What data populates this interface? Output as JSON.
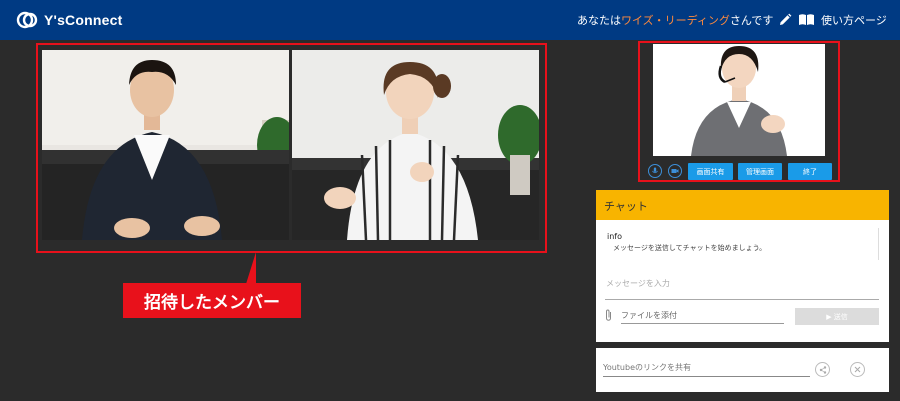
{
  "header": {
    "logo_text": "Y'sConnect",
    "greeting_prefix": "あなたは",
    "user_name": "ワイズ・リーディング",
    "greeting_suffix": "さんです",
    "help_label": "使い方ページ"
  },
  "callout": {
    "label": "招待したメンバー"
  },
  "operator_controls": {
    "share_screen": "画面共有",
    "manage_screen": "管理画面",
    "end": "終了"
  },
  "chat": {
    "title": "チャット",
    "info_title": "info",
    "info_message": "メッセージを送信してチャットを始めましょう。",
    "message_placeholder": "メッセージを入力",
    "file_placeholder": "ファイルを添付",
    "send_label": "▶ 送信"
  },
  "youtube": {
    "placeholder": "Youtubeのリンクを共有"
  },
  "colors": {
    "header": "#003a83",
    "highlight": "#e8111b",
    "chat_header": "#f8b400",
    "button": "#1a9be8",
    "user_name": "#ff8a3d"
  }
}
